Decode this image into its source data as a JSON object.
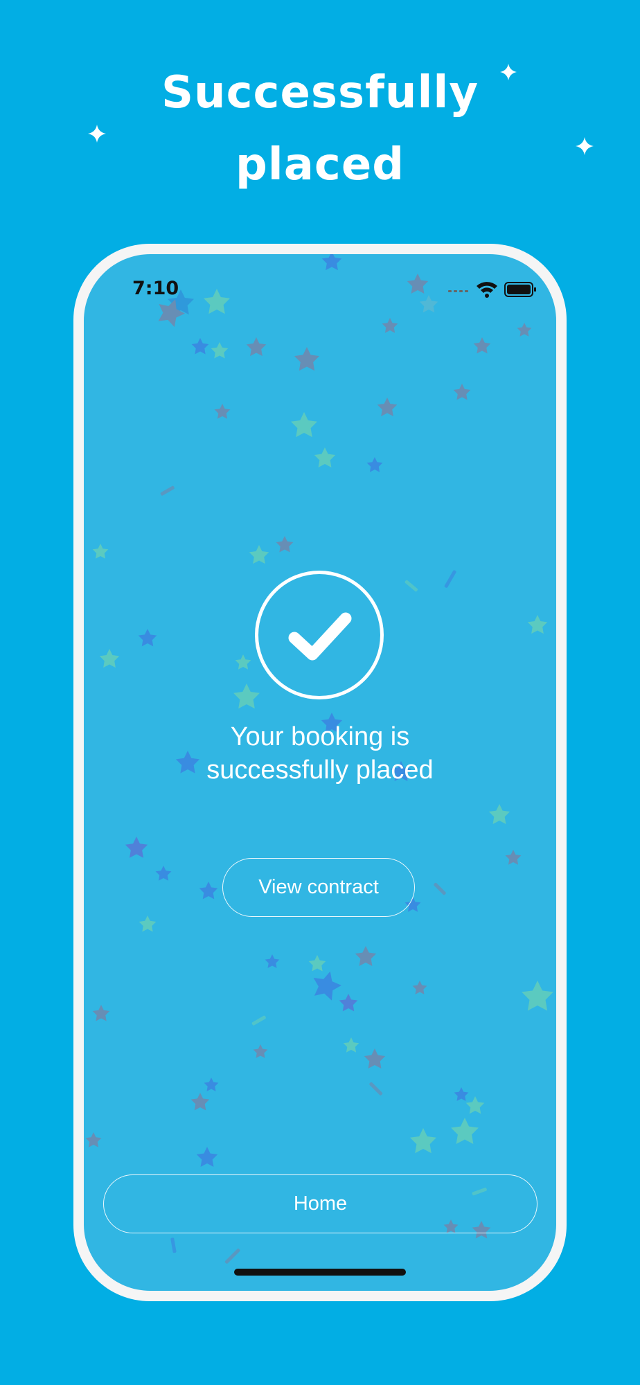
{
  "headline": {
    "line1": "Successfully",
    "line2": "placed"
  },
  "status_bar": {
    "time": "7:10",
    "icons": [
      "signal-icon",
      "wifi-icon",
      "battery-icon"
    ]
  },
  "main": {
    "icon": "checkmark-circle-icon",
    "message_line1": "Your booking is",
    "message_line2": "successfully placed",
    "view_contract_label": "View contract",
    "home_label": "Home"
  },
  "colors": {
    "background": "#02aee4",
    "screen": "#31b6e3",
    "frame": "#f5f5f5",
    "text": "#ffffff"
  }
}
